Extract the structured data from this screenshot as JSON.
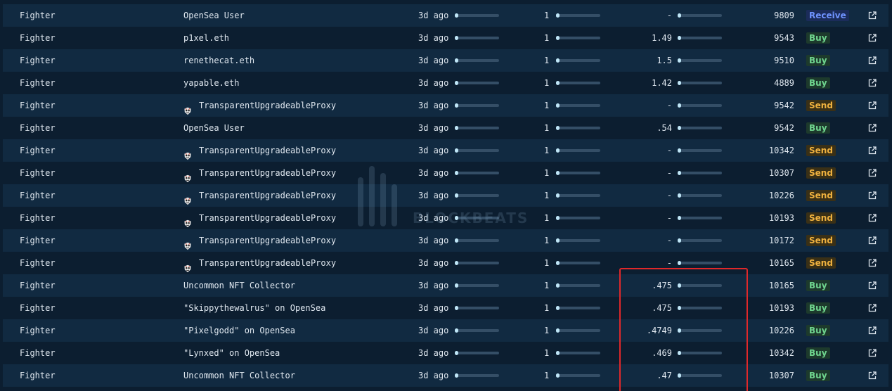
{
  "table": {
    "rows": [
      {
        "type": "Fighter",
        "name": "OpenSea User",
        "contract_icon": false,
        "time": "3d ago",
        "qty": "1",
        "price": "-",
        "token": "9809",
        "action": "Receive"
      },
      {
        "type": "Fighter",
        "name": "p1xel.eth",
        "contract_icon": false,
        "time": "3d ago",
        "qty": "1",
        "price": "1.49",
        "token": "9543",
        "action": "Buy"
      },
      {
        "type": "Fighter",
        "name": "renethecat.eth",
        "contract_icon": false,
        "time": "3d ago",
        "qty": "1",
        "price": "1.5",
        "token": "9510",
        "action": "Buy"
      },
      {
        "type": "Fighter",
        "name": "yapable.eth",
        "contract_icon": false,
        "time": "3d ago",
        "qty": "1",
        "price": "1.42",
        "token": "4889",
        "action": "Buy"
      },
      {
        "type": "Fighter",
        "name": "TransparentUpgradeableProxy",
        "contract_icon": true,
        "time": "3d ago",
        "qty": "1",
        "price": "-",
        "token": "9542",
        "action": "Send"
      },
      {
        "type": "Fighter",
        "name": "OpenSea User",
        "contract_icon": false,
        "time": "3d ago",
        "qty": "1",
        "price": ".54",
        "token": "9542",
        "action": "Buy"
      },
      {
        "type": "Fighter",
        "name": "TransparentUpgradeableProxy",
        "contract_icon": true,
        "time": "3d ago",
        "qty": "1",
        "price": "-",
        "token": "10342",
        "action": "Send"
      },
      {
        "type": "Fighter",
        "name": "TransparentUpgradeableProxy",
        "contract_icon": true,
        "time": "3d ago",
        "qty": "1",
        "price": "-",
        "token": "10307",
        "action": "Send"
      },
      {
        "type": "Fighter",
        "name": "TransparentUpgradeableProxy",
        "contract_icon": true,
        "time": "3d ago",
        "qty": "1",
        "price": "-",
        "token": "10226",
        "action": "Send"
      },
      {
        "type": "Fighter",
        "name": "TransparentUpgradeableProxy",
        "contract_icon": true,
        "time": "3d ago",
        "qty": "1",
        "price": "-",
        "token": "10193",
        "action": "Send"
      },
      {
        "type": "Fighter",
        "name": "TransparentUpgradeableProxy",
        "contract_icon": true,
        "time": "3d ago",
        "qty": "1",
        "price": "-",
        "token": "10172",
        "action": "Send"
      },
      {
        "type": "Fighter",
        "name": "TransparentUpgradeableProxy",
        "contract_icon": true,
        "time": "3d ago",
        "qty": "1",
        "price": "-",
        "token": "10165",
        "action": "Send"
      },
      {
        "type": "Fighter",
        "name": "Uncommon NFT Collector",
        "contract_icon": false,
        "time": "3d ago",
        "qty": "1",
        "price": ".475",
        "token": "10165",
        "action": "Buy"
      },
      {
        "type": "Fighter",
        "name": "\"Skippythewalrus\" on OpenSea",
        "contract_icon": false,
        "time": "3d ago",
        "qty": "1",
        "price": ".475",
        "token": "10193",
        "action": "Buy"
      },
      {
        "type": "Fighter",
        "name": "\"Pixelgodd\" on OpenSea",
        "contract_icon": false,
        "time": "3d ago",
        "qty": "1",
        "price": ".4749",
        "token": "10226",
        "action": "Buy"
      },
      {
        "type": "Fighter",
        "name": "\"Lynxed\" on OpenSea",
        "contract_icon": false,
        "time": "3d ago",
        "qty": "1",
        "price": ".469",
        "token": "10342",
        "action": "Buy"
      },
      {
        "type": "Fighter",
        "name": "Uncommon NFT Collector",
        "contract_icon": false,
        "time": "3d ago",
        "qty": "1",
        "price": ".47",
        "token": "10307",
        "action": "Buy"
      }
    ]
  },
  "watermark": {
    "text": "BLOCKBEATS"
  },
  "colors": {
    "buy": "#6fd58e",
    "send": "#f0b23f",
    "receive": "#6f93ff",
    "highlight": "#e0282a"
  },
  "icons": {
    "contract": "proxy-contract-icon",
    "external_link": "external-link-icon"
  }
}
